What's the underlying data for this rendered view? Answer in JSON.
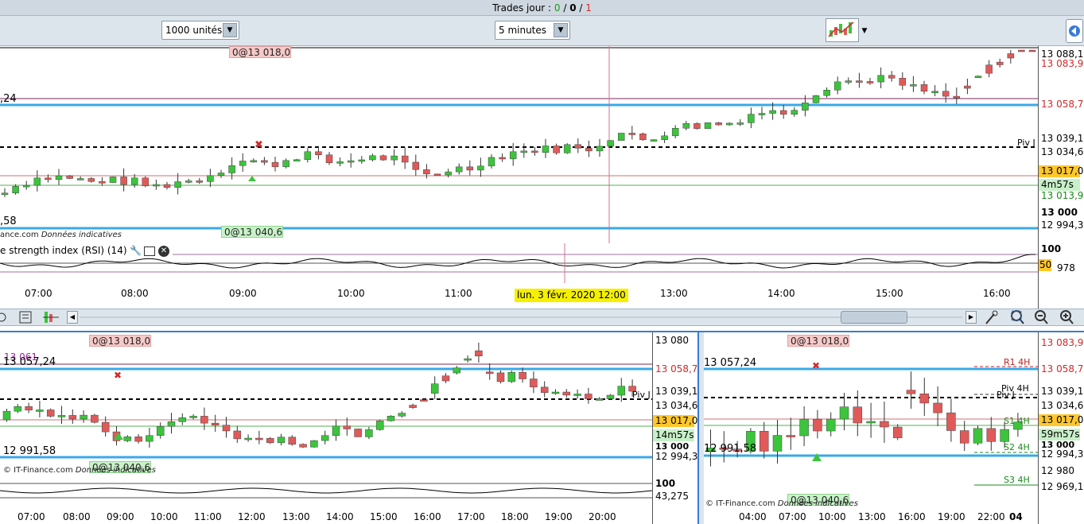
{
  "title_bar": {
    "prefix": "Trades jour : ",
    "val1": "0",
    "slash1": " / ",
    "val2": "0",
    "slash2": " / ",
    "val3": "1"
  },
  "toolbar": {
    "quantity": "1000 unités",
    "timeframe": "5 minutes"
  },
  "main_chart": {
    "badge_top": "0@13 018,0",
    "badge_bottom": "0@13 040,6",
    "left_level_top": ",24",
    "left_level_bottom": ",58",
    "piv_label": "Piv J",
    "credit": "ance.com",
    "credit_note": "Données indicatives",
    "axis": [
      "13 088,1",
      "13 083,9",
      "13 058,7",
      "13 039,1",
      "13 034,6",
      "13 017,0",
      "4m57s",
      "13 013,9",
      "13 000",
      "12 994,3"
    ],
    "rsi_title": "e strength index (RSI) (14)",
    "rsi_axis": [
      "100",
      "50",
      "978"
    ],
    "times": [
      "07:00",
      "08:00",
      "09:00",
      "10:00",
      "11:00",
      "13:00",
      "14:00",
      "15:00",
      "16:00"
    ],
    "cursor_date": "lun. 3 févr. 2020 12:00"
  },
  "bottom_left_chart": {
    "badge_top": "0@13 018,0",
    "badge_bottom": "0@13 040,6",
    "level_purple": "13 061",
    "level_top": "13 057,24",
    "level_bottom": "12 991,58",
    "piv_label": "Piv J",
    "credit": "© IT-Finance.com",
    "credit_note": "Données indicatives",
    "axis": [
      "13 080",
      "13 058,7",
      "13 039,1",
      "13 034,6",
      "13 017,0",
      "14m57s",
      "13 000",
      "12 994,3"
    ],
    "rsi_axis": [
      "100",
      "43,275"
    ],
    "times": [
      "07:00",
      "08:00",
      "09:00",
      "10:00",
      "11:00",
      "12:00",
      "13:00",
      "14:00",
      "15:00",
      "16:00",
      "17:00",
      "18:00",
      "19:00",
      "20:00"
    ]
  },
  "bottom_right_chart": {
    "badge_top": "0@13 018,0",
    "badge_bottom": "0@13 040,6",
    "level_top": "13 057,24",
    "level_bottom": "12 991,58",
    "labels": [
      "R1 4H",
      "Piv 4H",
      "Piv J",
      "S1 4H",
      "S2 4H",
      "S3 4H"
    ],
    "credit": "© IT-Finance.com",
    "credit_note": "Données indicatives",
    "axis": [
      "13 083,9",
      "13 058,7",
      "13 039,1",
      "13 034,6",
      "13 017,0",
      "59m57s",
      "13 000",
      "12 994,3",
      "12 980",
      "12 969,1"
    ],
    "times": [
      "04:00",
      "07:00",
      "10:00",
      "13:00",
      "16:00",
      "19:00",
      "22:00",
      "04"
    ]
  },
  "colors": {
    "up": "#3cc43c",
    "down": "#e05a5a",
    "blue_level": "#3aa8e8",
    "accent": "#ffc72c"
  }
}
